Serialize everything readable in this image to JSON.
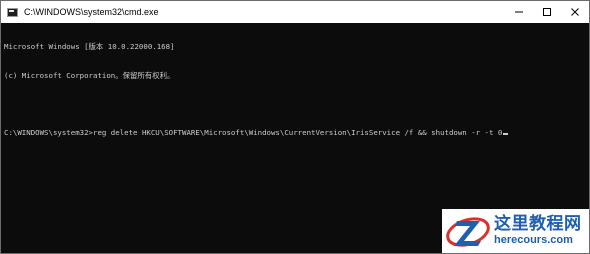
{
  "window": {
    "title": "C:\\WINDOWS\\system32\\cmd.exe",
    "icon": "cmd-icon",
    "controls": [
      "minimize-icon",
      "maximize-icon",
      "close-icon"
    ]
  },
  "console": {
    "lines": [
      "Microsoft Windows [版本 10.0.22000.168]",
      "(c) Microsoft Corporation。保留所有权利。"
    ],
    "prompt": "C:\\WINDOWS\\system32>",
    "command": "reg delete HKCU\\SOFTWARE\\Microsoft\\Windows\\CurrentVersion\\IrisService /f && shutdown -r -t 0"
  },
  "watermark": {
    "title": "这里教程网",
    "domain": "herecours.com"
  },
  "colors": {
    "console_bg": "#0c0c0c",
    "console_text": "#cccccc",
    "titlebar_bg": "#ffffff",
    "watermark_blue": "#1f5fb0",
    "watermark_red": "#d9322b"
  }
}
